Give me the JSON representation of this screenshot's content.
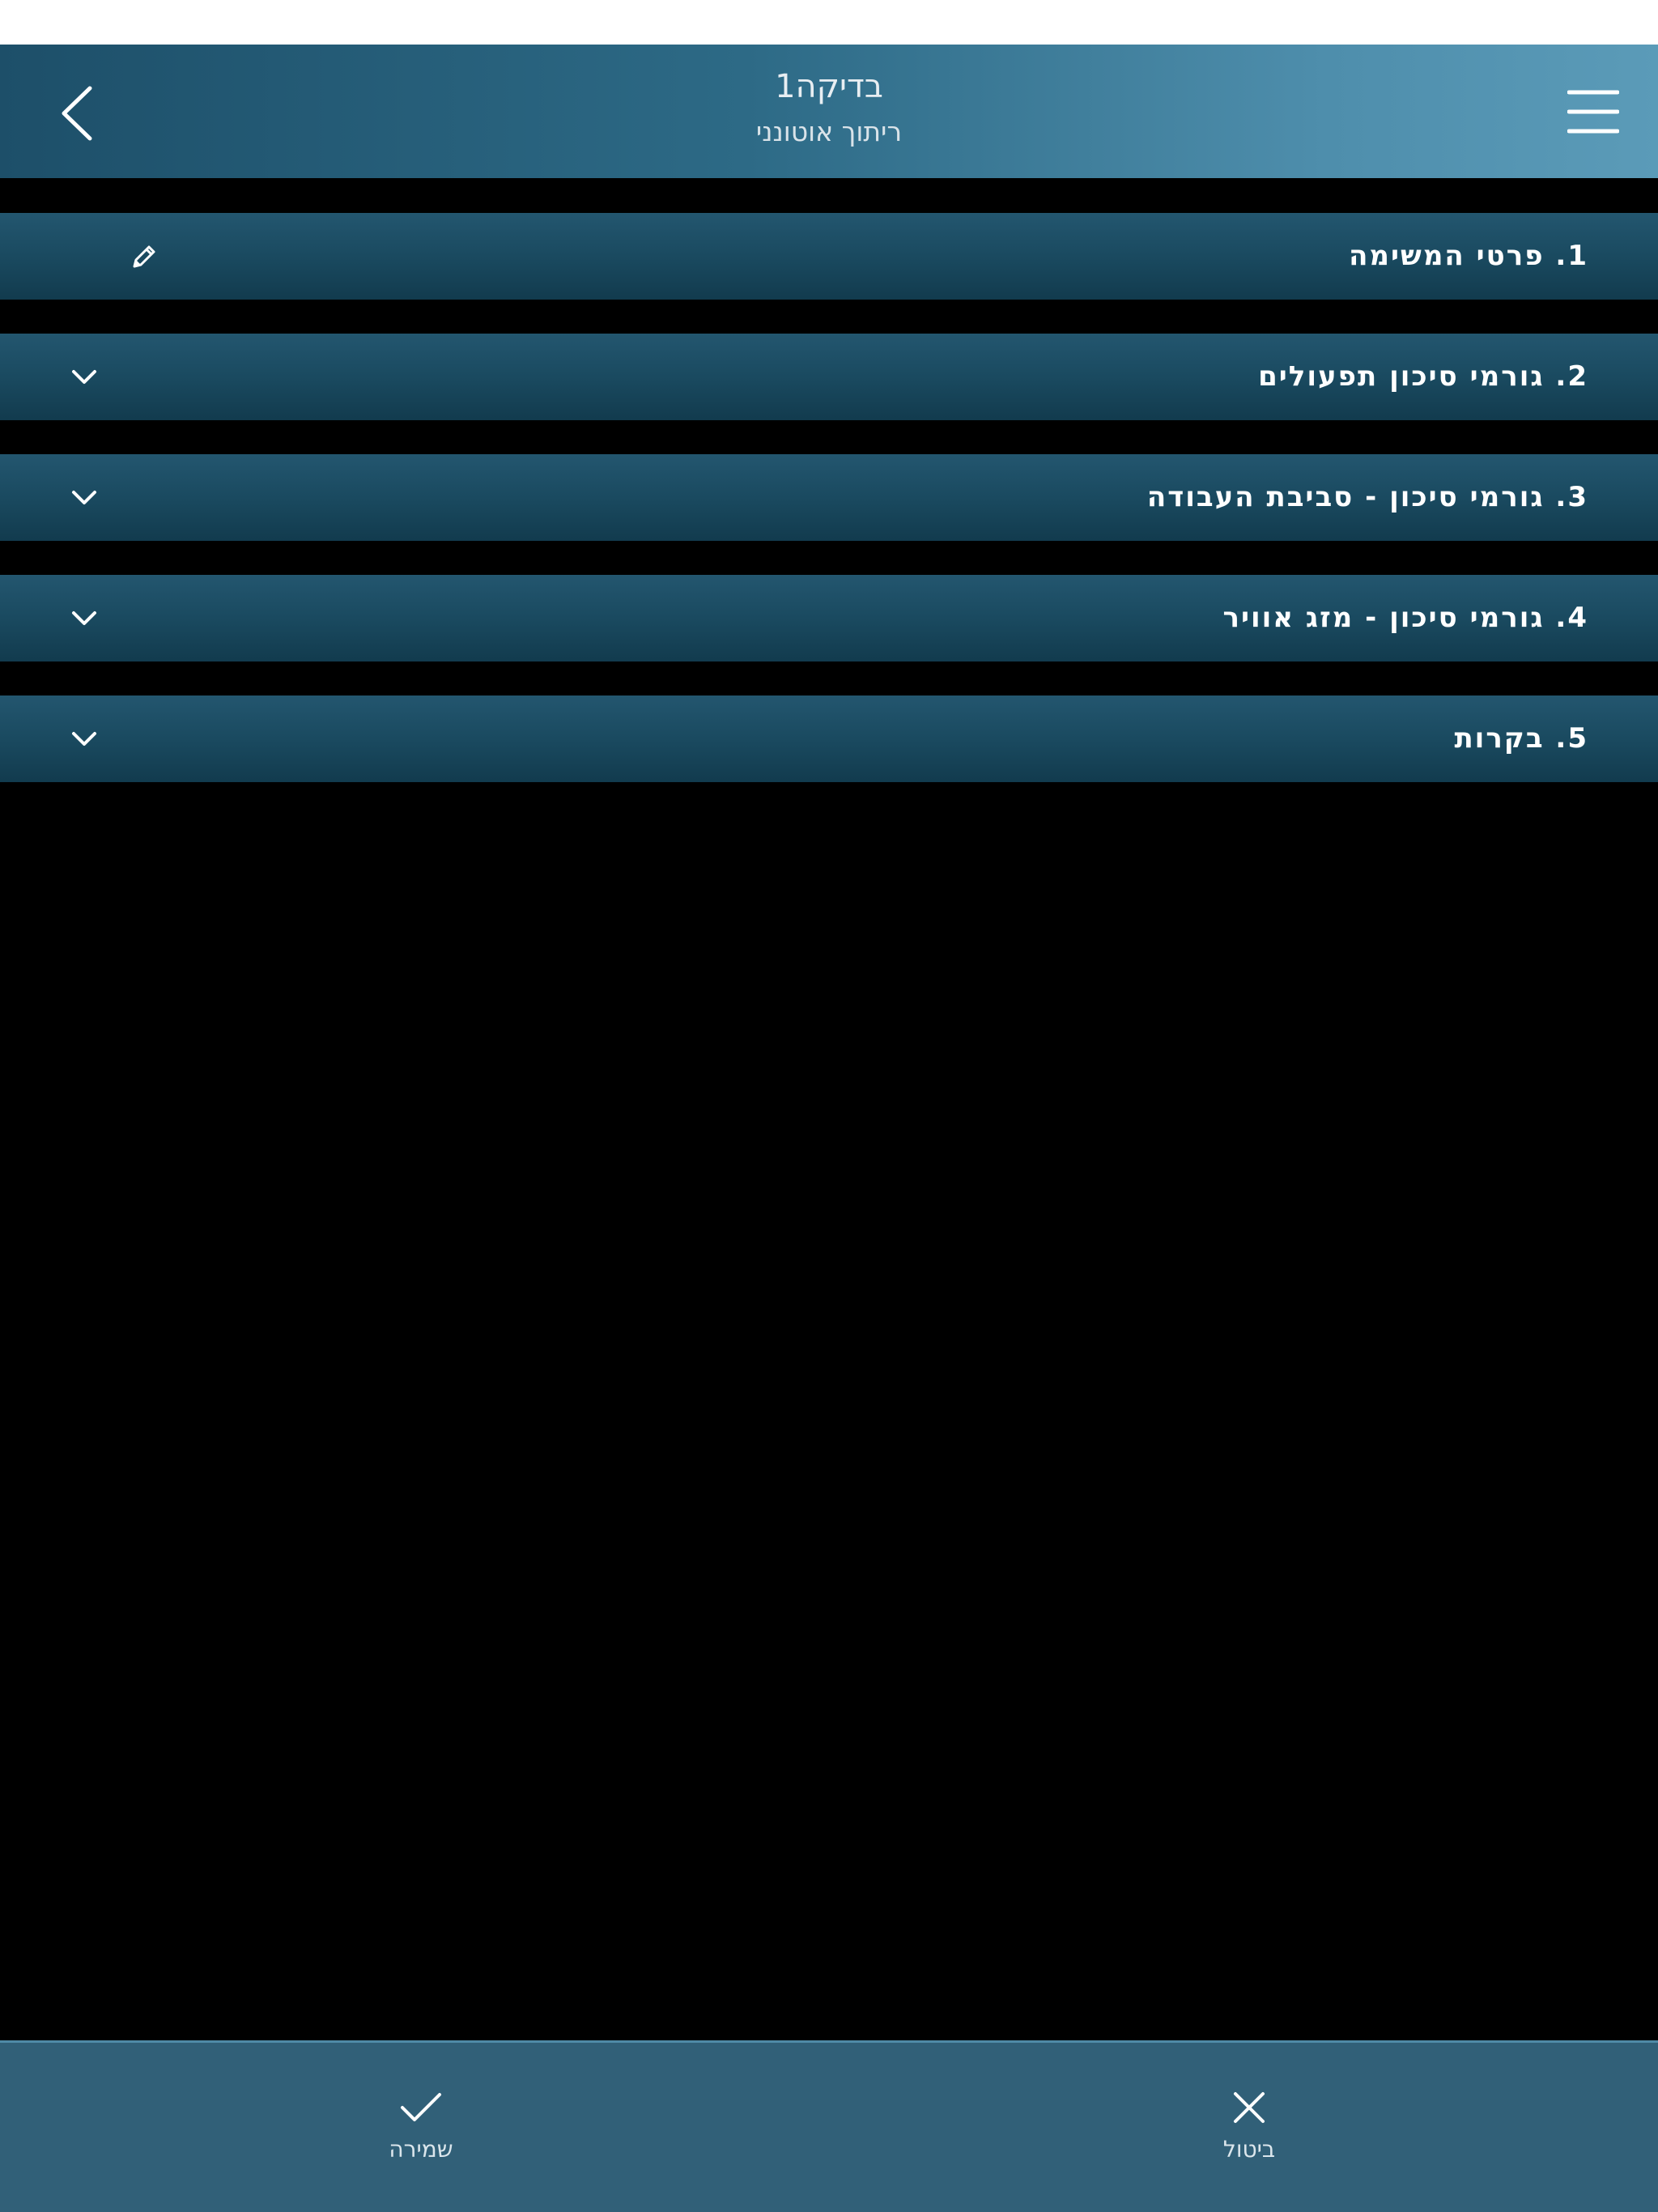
{
  "header": {
    "title": "בדיקה1",
    "subtitle": "ריתוך אוטונני"
  },
  "sections": [
    {
      "label": "1. פרטי המשימה",
      "icon": "pencil-icon"
    },
    {
      "label": "2. גורמי סיכון תפעולים",
      "icon": "chevron-down-icon"
    },
    {
      "label": "3. גורמי סיכון - סביבת העבודה",
      "icon": "chevron-down-icon"
    },
    {
      "label": "4. גורמי סיכון - מזג אוויר",
      "icon": "chevron-down-icon"
    },
    {
      "label": "5. בקרות",
      "icon": "chevron-down-icon"
    }
  ],
  "footer": {
    "save_label": "שמירה",
    "cancel_label": "ביטול"
  },
  "colors": {
    "header_gradient_start": "#1d4f69",
    "header_gradient_end": "#5b9bb8",
    "section_bg": "#1a4a60",
    "footer_bg": "#316078",
    "background": "#000000"
  }
}
